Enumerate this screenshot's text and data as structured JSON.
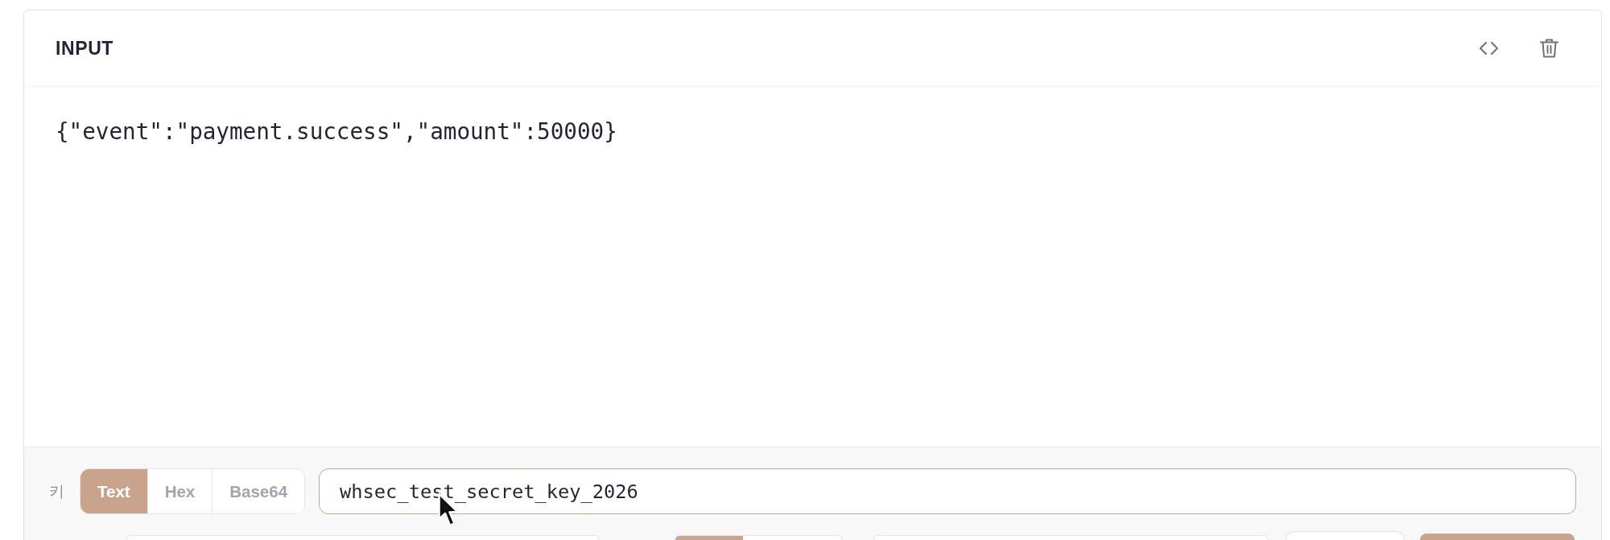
{
  "panel": {
    "title": "INPUT",
    "actions": [
      {
        "kind": "code"
      },
      {
        "kind": "delete"
      }
    ]
  },
  "editor": {
    "value": "{\"event\":\"payment.success\",\"amount\":50000}"
  },
  "key_row": {
    "label": "키",
    "formats": [
      {
        "label": "Text",
        "selected": true
      },
      {
        "label": "Hex",
        "selected": false
      },
      {
        "label": "Base64",
        "selected": false
      }
    ],
    "input": {
      "value": "whsec_test_secret_key_2026",
      "focused": true
    }
  },
  "row_2": [
    {
      "kind": "field"
    },
    {
      "kind": "segmented",
      "segments": [
        {
          "selected": true
        },
        {
          "selected": false
        }
      ]
    },
    {
      "kind": "field"
    },
    {
      "kind": "button"
    },
    {
      "kind": "primary-button"
    }
  ]
}
